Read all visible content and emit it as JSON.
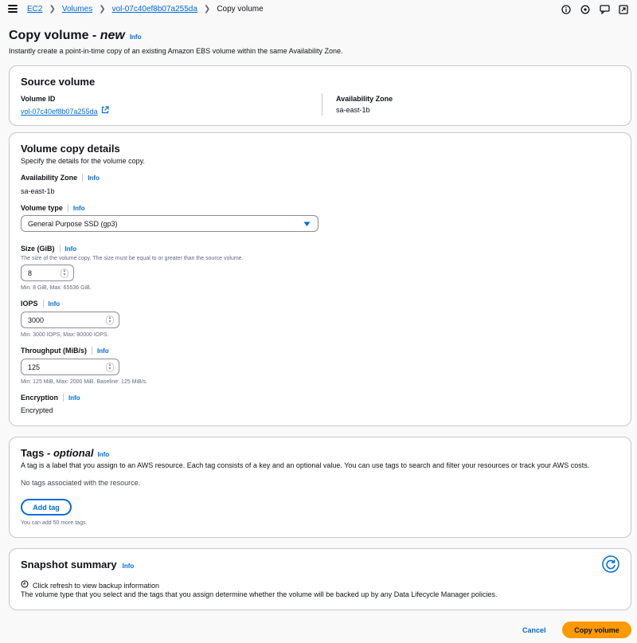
{
  "breadcrumb": {
    "items": [
      "EC2",
      "Volumes",
      "vol-07c40ef8b07a255da"
    ],
    "current": "Copy volume"
  },
  "header": {
    "title": "Copy volume - ",
    "title_em": "new",
    "info": "Info",
    "description": "Instantly create a point-in-time copy of an existing Amazon EBS volume within the same Availability Zone."
  },
  "source": {
    "title": "Source volume",
    "volume_id_label": "Volume ID",
    "volume_id": "vol-07c40ef8b07a255da",
    "az_label": "Availability Zone",
    "az": "sa-east-1b"
  },
  "details": {
    "title": "Volume copy details",
    "description": "Specify the details for the volume copy.",
    "az_label": "Availability Zone",
    "az_info": "Info",
    "az_value": "sa-east-1b",
    "type_label": "Volume type",
    "type_info": "Info",
    "type_value": "General Purpose SSD (gp3)",
    "size_label": "Size (GiB)",
    "size_info": "Info",
    "size_desc": "The size of the volume copy. The size must be equal to or greater than the source volume.",
    "size_value": "8",
    "size_hint": "Min: 8 GiB, Max: 65536 GiB.",
    "iops_label": "IOPS",
    "iops_info": "Info",
    "iops_value": "3000",
    "iops_hint": "Min: 3000 IOPS, Max: 80000 IOPS.",
    "throughput_label": "Throughput (MiB/s)",
    "throughput_info": "Info",
    "throughput_value": "125",
    "throughput_hint": "Min: 125 MiB, Max: 2000 MiB. Baseline: 125 MiB/s.",
    "encryption_label": "Encryption",
    "encryption_info": "Info",
    "encryption_value": "Encrypted"
  },
  "tags": {
    "title": "Tags - ",
    "title_em": "optional",
    "info": "Info",
    "description": "A tag is a label that you assign to an AWS resource. Each tag consists of a key and an optional value. You can use tags to search and filter your resources or track your AWS costs.",
    "empty": "No tags associated with the resource.",
    "add_label": "Add tag",
    "hint": "You can add 50 more tags."
  },
  "snapshot": {
    "title": "Snapshot summary",
    "info": "Info",
    "refresh_text": "Click refresh to view backup information",
    "description": "The volume type that you select and the tags that you assign determine whether the volume will be backed up by any Data Lifecycle Manager policies."
  },
  "footer": {
    "cancel_label": "Cancel",
    "submit_label": "Copy volume"
  },
  "colors": {
    "accent": "#006ce0",
    "primary_button": "#ff9900",
    "border": "#c6c6cd"
  }
}
